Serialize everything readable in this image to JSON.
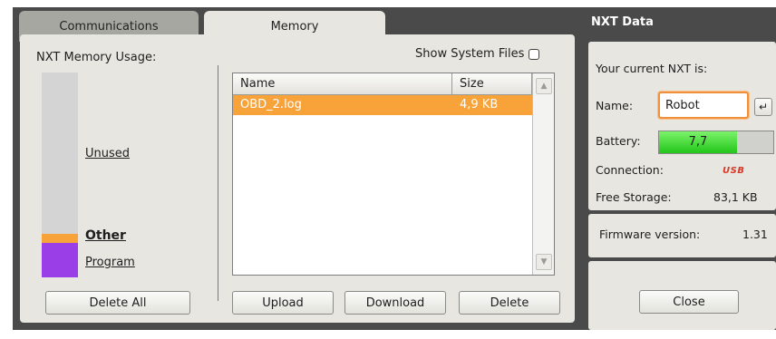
{
  "tabs": [
    {
      "label": "Communications",
      "active": false
    },
    {
      "label": "Memory",
      "active": true
    }
  ],
  "memory": {
    "usage_label": "NXT Memory Usage:",
    "legend": {
      "unused": "Unused",
      "other": "Other",
      "program": "Program"
    },
    "usage_fractions": {
      "unused": 0.66,
      "other": 0.04,
      "program": 0.14
    },
    "colors": {
      "unused": "#d4d4d4",
      "other": "#f8a23a",
      "program": "#9a3fe8"
    },
    "delete_all_label": "Delete All",
    "show_system_files_label": "Show System Files",
    "show_system_files_checked": false,
    "columns": {
      "name": "Name",
      "size": "Size"
    },
    "files": [
      {
        "name": "OBD_2.log",
        "size": "4,9 KB",
        "selected": true
      }
    ],
    "upload_label": "Upload",
    "download_label": "Download",
    "delete_label": "Delete"
  },
  "nxt": {
    "title": "NXT Data",
    "current_label": "Your current NXT is:",
    "name_label": "Name:",
    "name_value": "Robot",
    "enter_icon": "enter-icon",
    "battery_label": "Battery:",
    "battery_value": "7,7",
    "battery_fraction": 0.68,
    "connection_label": "Connection:",
    "connection_value": "USB",
    "free_storage_label": "Free Storage:",
    "free_storage_value": "83,1 KB",
    "firmware_label": "Firmware version:",
    "firmware_value": "1.31",
    "close_label": "Close"
  },
  "accent_color": "#f8a23a"
}
